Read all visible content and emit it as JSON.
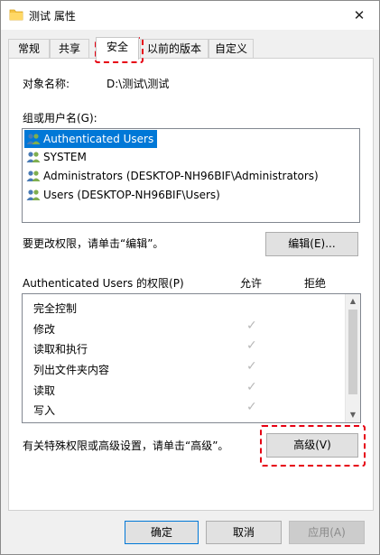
{
  "window": {
    "title": "测试 属性"
  },
  "tabs": [
    {
      "label": "常规"
    },
    {
      "label": "共享"
    },
    {
      "label": "安全"
    },
    {
      "label": "以前的版本"
    },
    {
      "label": "自定义"
    }
  ],
  "object": {
    "label": "对象名称:",
    "value": "D:\\测试\\测试"
  },
  "groups": {
    "label": "组或用户名(G):",
    "items": [
      {
        "name": "Authenticated Users",
        "selected": true
      },
      {
        "name": "SYSTEM"
      },
      {
        "name": "Administrators (DESKTOP-NH96BIF\\Administrators)"
      },
      {
        "name": "Users (DESKTOP-NH96BIF\\Users)"
      }
    ]
  },
  "edit": {
    "hint": "要更改权限，请单击“编辑”。",
    "button": "编辑(E)..."
  },
  "permissions": {
    "header": "Authenticated Users 的权限(P)",
    "allow_label": "允许",
    "deny_label": "拒绝",
    "rows": [
      {
        "name": "完全控制",
        "allow": false
      },
      {
        "name": "修改",
        "allow": true
      },
      {
        "name": "读取和执行",
        "allow": true
      },
      {
        "name": "列出文件夹内容",
        "allow": true
      },
      {
        "name": "读取",
        "allow": true
      },
      {
        "name": "写入",
        "allow": true
      }
    ]
  },
  "advanced": {
    "hint": "有关特殊权限或高级设置，请单击“高级”。",
    "button": "高级(V)"
  },
  "footer": {
    "ok": "确定",
    "cancel": "取消",
    "apply": "应用(A)"
  }
}
